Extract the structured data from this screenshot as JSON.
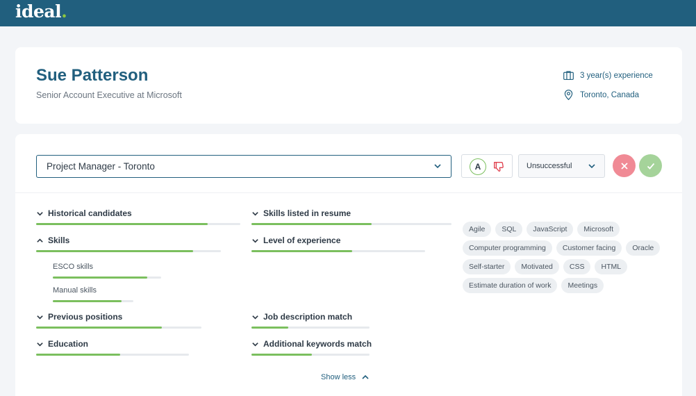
{
  "app": {
    "logo": "ideal",
    "logo_dot": "."
  },
  "candidate": {
    "name": "Sue Patterson",
    "headline": "Senior Account Executive at Microsoft",
    "experience": "3 year(s) experience",
    "location": "Toronto, Canada"
  },
  "toolbar": {
    "job": "Project Manager - Toronto",
    "ai_badge": "A",
    "status": "Unsuccessful"
  },
  "sections_left": [
    {
      "label": "Historical candidates",
      "fill": 0.84,
      "expanded": false
    },
    {
      "label": "Skills",
      "fill": 0.85,
      "expanded": true
    },
    {
      "label": "ESCO skills",
      "fill": 0.87
    },
    {
      "label": "Manual skills",
      "fill": 0.85
    },
    {
      "label": "Previous positions",
      "fill": 0.76,
      "expanded": false
    },
    {
      "label": "Education",
      "fill": 0.55,
      "expanded": false
    }
  ],
  "sections_right": [
    {
      "label": "Skills listed in resume",
      "fill": 0.6,
      "expanded": false
    },
    {
      "label": "Level of experience",
      "fill": 0.58,
      "expanded": false
    },
    {
      "label": "Job description match",
      "fill": 0.31,
      "expanded": false
    },
    {
      "label": "Additional keywords match",
      "fill": 0.51,
      "expanded": false
    }
  ],
  "skills_tags": [
    "Agile",
    "SQL",
    "JavaScript",
    "Microsoft",
    "Computer programming",
    "Customer facing",
    "Oracle",
    "Self-starter",
    "Motivated",
    "CSS",
    "HTML",
    "Estimate duration of work",
    "Meetings"
  ],
  "footer": {
    "show_less": "Show less"
  },
  "colors": {
    "brand": "#215f7e",
    "accent": "#7bbf5e",
    "reject": "#f08a95",
    "accept": "#a5d39a"
  }
}
